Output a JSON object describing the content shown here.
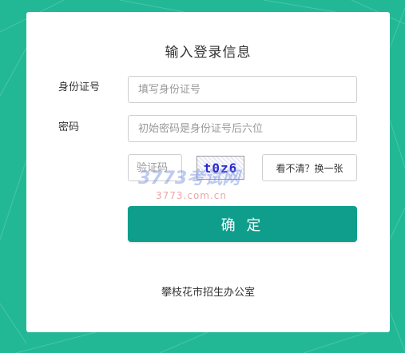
{
  "form": {
    "title": "输入登录信息",
    "id_label": "身份证号",
    "id_placeholder": "填写身份证号",
    "password_label": "密码",
    "password_placeholder": "初始密码是身份证号后六位",
    "captcha_placeholder": "验证码",
    "captcha_image_text": "t0z6",
    "refresh_label": "看不清？换一张",
    "submit_label": "确 定"
  },
  "footer": {
    "org": "攀枝花市招生办公室"
  },
  "watermark": {
    "top": "3773考试网",
    "bottom": "3773.com.cn"
  },
  "colors": {
    "background": "#22b896",
    "primary_button": "#0f9d8c"
  }
}
